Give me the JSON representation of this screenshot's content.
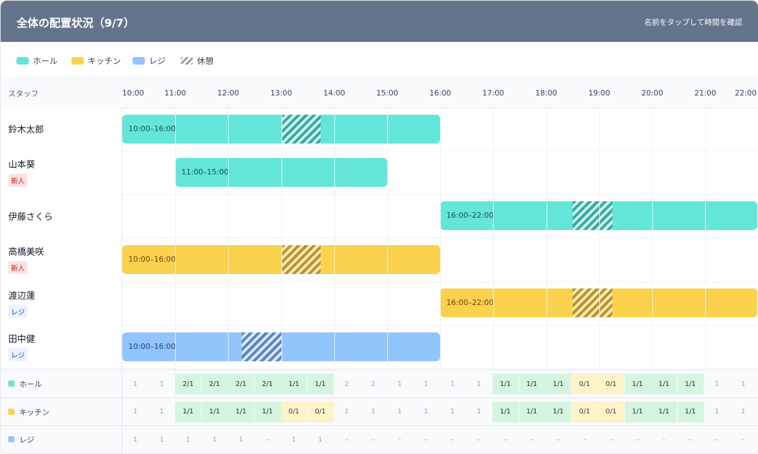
{
  "header": {
    "title": "全体の配置状況（9/7）",
    "hint": "名前をタップして時間を確認"
  },
  "legend": [
    {
      "label": "ホール",
      "kind": "hall"
    },
    {
      "label": "キッチン",
      "kind": "kitchen"
    },
    {
      "label": "レジ",
      "kind": "register"
    },
    {
      "label": "休憩",
      "kind": "break"
    }
  ],
  "grid": {
    "staff_header": "スタッフ",
    "times": [
      "10:00",
      "11:00",
      "12:00",
      "13:00",
      "14:00",
      "15:00",
      "16:00",
      "17:00",
      "18:00",
      "19:00",
      "20:00",
      "21:00",
      "22:00"
    ]
  },
  "staff": [
    {
      "name": "鈴木太郎",
      "tag": "",
      "role": "hall",
      "start": 10,
      "end": 16,
      "label": "10:00–16:00",
      "break_start": 13,
      "break_end": 13.75
    },
    {
      "name": "山本葵",
      "tag": "新人",
      "role": "hall",
      "start": 11,
      "end": 15,
      "label": "11:00–15:00",
      "break_start": null,
      "break_end": null
    },
    {
      "name": "伊藤さくら",
      "tag": "",
      "role": "hall",
      "start": 16,
      "end": 22,
      "label": "16:00–22:00",
      "break_start": 18.5,
      "break_end": 19.25
    },
    {
      "name": "高橋美咲",
      "tag": "新人",
      "role": "kitchen",
      "start": 10,
      "end": 16,
      "label": "10:00–16:00",
      "break_start": 13,
      "break_end": 13.75
    },
    {
      "name": "渡辺蓮",
      "tag": "レジ",
      "role": "kitchen",
      "start": 16,
      "end": 22,
      "label": "16:00–22:00",
      "break_start": 18.5,
      "break_end": 19.25
    },
    {
      "name": "田中健",
      "tag": "レジ",
      "role": "register",
      "start": 10,
      "end": 16,
      "label": "10:00–16:00",
      "break_start": 12.25,
      "break_end": 13
    }
  ],
  "summary": [
    {
      "label": "ホール",
      "kind": "hall",
      "cells": [
        {
          "v": "1",
          "s": "plain"
        },
        {
          "v": "1",
          "s": "plain"
        },
        {
          "v": "2/1",
          "s": "ok"
        },
        {
          "v": "2/1",
          "s": "ok"
        },
        {
          "v": "2/1",
          "s": "ok"
        },
        {
          "v": "2/1",
          "s": "ok"
        },
        {
          "v": "1/1",
          "s": "ok"
        },
        {
          "v": "1/1",
          "s": "ok"
        },
        {
          "v": "2",
          "s": "plain"
        },
        {
          "v": "2",
          "s": "plain"
        },
        {
          "v": "1",
          "s": "plain"
        },
        {
          "v": "1",
          "s": "plain"
        },
        {
          "v": "1",
          "s": "plain"
        },
        {
          "v": "1",
          "s": "plain"
        },
        {
          "v": "1/1",
          "s": "ok"
        },
        {
          "v": "1/1",
          "s": "ok"
        },
        {
          "v": "1/1",
          "s": "ok"
        },
        {
          "v": "0/1",
          "s": "short"
        },
        {
          "v": "0/1",
          "s": "short"
        },
        {
          "v": "1/1",
          "s": "ok"
        },
        {
          "v": "1/1",
          "s": "ok"
        },
        {
          "v": "1/1",
          "s": "ok"
        },
        {
          "v": "1",
          "s": "plain"
        },
        {
          "v": "1",
          "s": "plain"
        }
      ]
    },
    {
      "label": "キッチン",
      "kind": "kitchen",
      "cells": [
        {
          "v": "1",
          "s": "plain"
        },
        {
          "v": "1",
          "s": "plain"
        },
        {
          "v": "1/1",
          "s": "ok"
        },
        {
          "v": "1/1",
          "s": "ok"
        },
        {
          "v": "1/1",
          "s": "ok"
        },
        {
          "v": "1/1",
          "s": "ok"
        },
        {
          "v": "0/1",
          "s": "short"
        },
        {
          "v": "0/1",
          "s": "short"
        },
        {
          "v": "1",
          "s": "plain"
        },
        {
          "v": "1",
          "s": "plain"
        },
        {
          "v": "1",
          "s": "plain"
        },
        {
          "v": "1",
          "s": "plain"
        },
        {
          "v": "1",
          "s": "plain"
        },
        {
          "v": "1",
          "s": "plain"
        },
        {
          "v": "1/1",
          "s": "ok"
        },
        {
          "v": "1/1",
          "s": "ok"
        },
        {
          "v": "1/1",
          "s": "ok"
        },
        {
          "v": "0/1",
          "s": "short"
        },
        {
          "v": "0/1",
          "s": "short"
        },
        {
          "v": "1/1",
          "s": "ok"
        },
        {
          "v": "1/1",
          "s": "ok"
        },
        {
          "v": "1/1",
          "s": "ok"
        },
        {
          "v": "1",
          "s": "plain"
        },
        {
          "v": "1",
          "s": "plain"
        }
      ]
    },
    {
      "label": "レジ",
      "kind": "register",
      "cells": [
        {
          "v": "1",
          "s": "plain"
        },
        {
          "v": "1",
          "s": "plain"
        },
        {
          "v": "1",
          "s": "plain"
        },
        {
          "v": "1",
          "s": "plain"
        },
        {
          "v": "1",
          "s": "plain"
        },
        {
          "v": "–",
          "s": "plain"
        },
        {
          "v": "1",
          "s": "plain"
        },
        {
          "v": "1",
          "s": "plain"
        },
        {
          "v": "–",
          "s": "plain"
        },
        {
          "v": "–",
          "s": "plain"
        },
        {
          "v": "–",
          "s": "plain"
        },
        {
          "v": "–",
          "s": "plain"
        },
        {
          "v": "–",
          "s": "plain"
        },
        {
          "v": "–",
          "s": "plain"
        },
        {
          "v": "–",
          "s": "plain"
        },
        {
          "v": "–",
          "s": "plain"
        },
        {
          "v": "–",
          "s": "plain"
        },
        {
          "v": "–",
          "s": "plain"
        },
        {
          "v": "–",
          "s": "plain"
        },
        {
          "v": "–",
          "s": "plain"
        },
        {
          "v": "–",
          "s": "plain"
        },
        {
          "v": "–",
          "s": "plain"
        },
        {
          "v": "–",
          "s": "plain"
        },
        {
          "v": "–",
          "s": "plain"
        }
      ]
    }
  ],
  "colors": {
    "hall": "#63e6d8",
    "kitchen": "#fbd24e",
    "register": "#93c5fd",
    "header": "#64748b"
  }
}
